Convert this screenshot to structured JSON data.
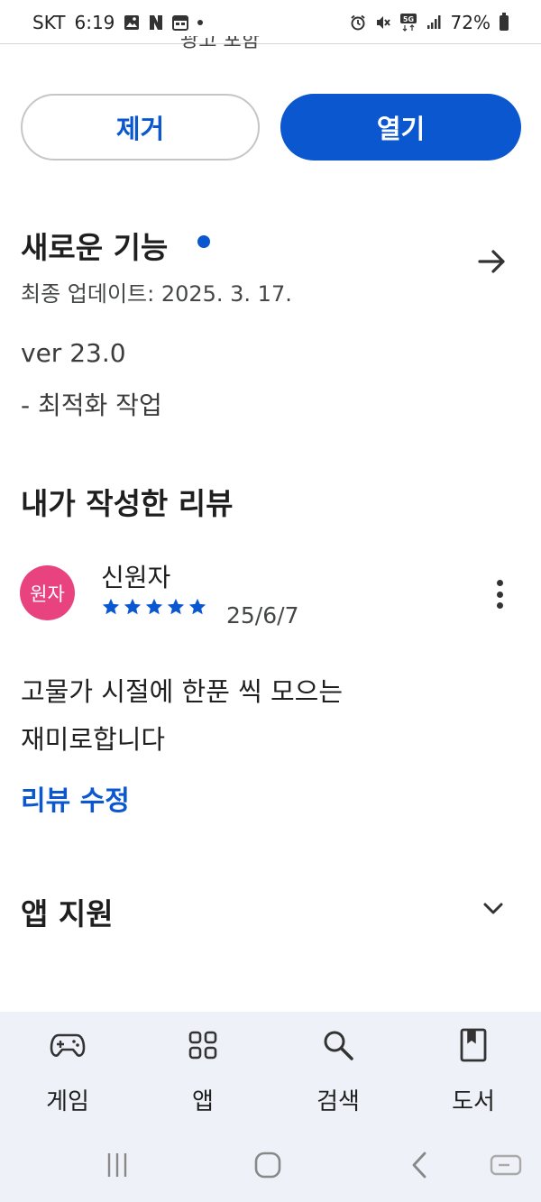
{
  "status_bar": {
    "carrier": "SKT",
    "time": "6:19",
    "battery_percent": "72%",
    "network": "5G"
  },
  "header_fragment": "광고 포함",
  "buttons": {
    "remove_label": "제거",
    "open_label": "열기"
  },
  "whats_new": {
    "title": "새로운 기능",
    "last_updated": "최종 업데이트: 2025. 3. 17.",
    "version": "ver 23.0",
    "notes": "- 최적화 작업"
  },
  "my_review": {
    "title": "내가 작성한 리뷰",
    "avatar_text": "원자",
    "avatar_color": "#e8437f",
    "reviewer_name": "신원자",
    "rating": 5,
    "rating_max": 5,
    "date": "25/6/7",
    "text_line1": "고물가 시절에 한푼 씩 모으는",
    "text_line2": "재미로합니다",
    "edit_label": "리뷰 수정"
  },
  "app_support": {
    "title": "앱 지원"
  },
  "bottom_nav": {
    "games": "게임",
    "apps": "앱",
    "search": "검색",
    "books": "도서"
  },
  "colors": {
    "accent": "#0b57d0",
    "nav_bg": "#eef1f8"
  }
}
